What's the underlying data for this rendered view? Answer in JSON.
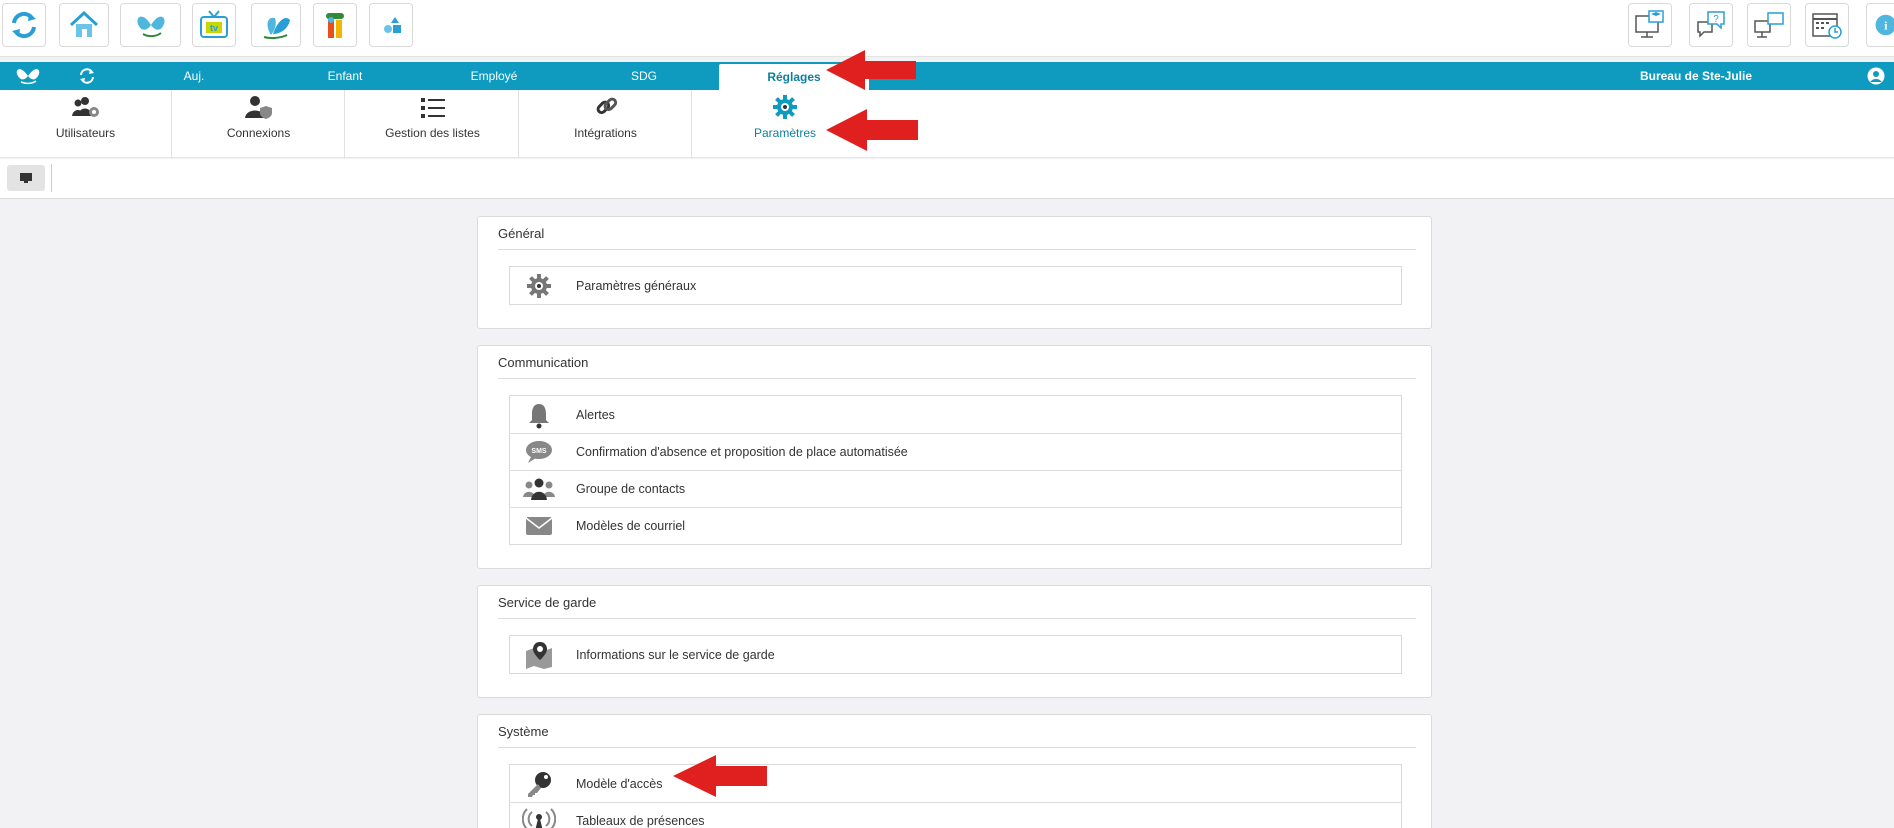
{
  "app_icons": [
    "refresh-icon",
    "home-icon",
    "butterfly-logo-icon",
    "tv-icon",
    "butterfly-alt-icon",
    "kids-icon",
    "shapes-icon"
  ],
  "right_icons": [
    "training-monitor-icon",
    "help-chat-icon",
    "remote-desktop-icon",
    "calendar-clock-icon",
    "info-icon"
  ],
  "nav": {
    "items": [
      "Auj.",
      "Enfant",
      "Employé",
      "SDG",
      "Réglages"
    ],
    "active": "Réglages",
    "office": "Bureau de Ste-Julie"
  },
  "subnav": {
    "items": [
      "Utilisateurs",
      "Connexions",
      "Gestion des listes",
      "Intégrations",
      "Paramètres"
    ],
    "active": "Paramètres"
  },
  "sections": [
    {
      "title": "Général",
      "items": [
        {
          "label": "Paramètres généraux",
          "icon": "gear-icon"
        }
      ]
    },
    {
      "title": "Communication",
      "items": [
        {
          "label": "Alertes",
          "icon": "bell-icon"
        },
        {
          "label": "Confirmation d'absence et proposition de place automatisée",
          "icon": "sms-icon"
        },
        {
          "label": "Groupe de contacts",
          "icon": "contacts-group-icon"
        },
        {
          "label": "Modèles de courriel",
          "icon": "envelope-icon"
        }
      ]
    },
    {
      "title": "Service de garde",
      "items": [
        {
          "label": "Informations sur le service de garde",
          "icon": "map-pin-icon"
        }
      ]
    },
    {
      "title": "Système",
      "items": [
        {
          "label": "Modèle d'accès",
          "icon": "key-icon"
        },
        {
          "label": "Tableaux de présences",
          "icon": "antenna-icon"
        }
      ]
    }
  ],
  "colors": {
    "accent": "#0e9bbf",
    "arrow": "#e0201f"
  }
}
